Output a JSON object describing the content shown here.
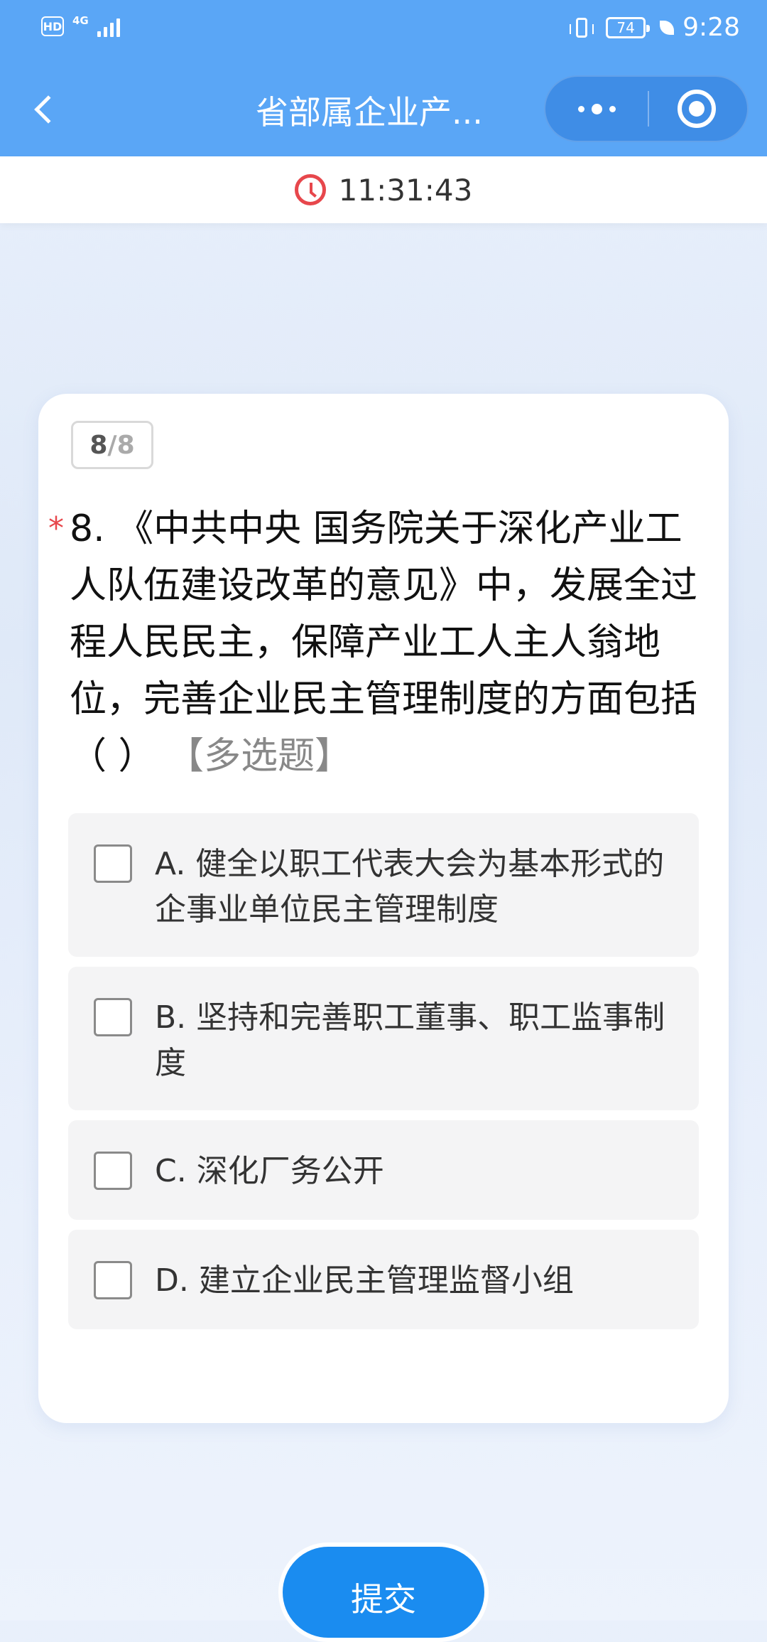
{
  "status_bar": {
    "hd": "HD",
    "network": "4G",
    "battery_level": "74",
    "time": "9:28"
  },
  "nav": {
    "title": "省部属企业产..."
  },
  "timer": {
    "value": "11:31:43",
    "icon_color": "#e7474c"
  },
  "card": {
    "progress": {
      "current": "8",
      "separator": "/",
      "total": "8"
    },
    "question": {
      "required_mark": "*",
      "text": "8. 《中共中央  国务院关于深化产业工人队伍建设改革的意见》中，发展全过程人民民主，保障产业工人主人翁地位，完善企业民主管理制度的方面包括（ ）",
      "type_label": "【多选题】"
    },
    "options": [
      {
        "label": "A. 健全以职工代表大会为基本形式的企事业单位民主管理制度",
        "checked": false
      },
      {
        "label": "B. 坚持和完善职工董事、职工监事制度",
        "checked": false
      },
      {
        "label": "C. 深化厂务公开",
        "checked": false
      },
      {
        "label": "D. 建立企业民主管理监督小组",
        "checked": false
      }
    ]
  },
  "submit": {
    "label": "提交"
  },
  "colors": {
    "header": "#5aa6f6",
    "capsule": "#3f8de6",
    "submit": "#1a8cf0",
    "required": "#e7474c"
  }
}
